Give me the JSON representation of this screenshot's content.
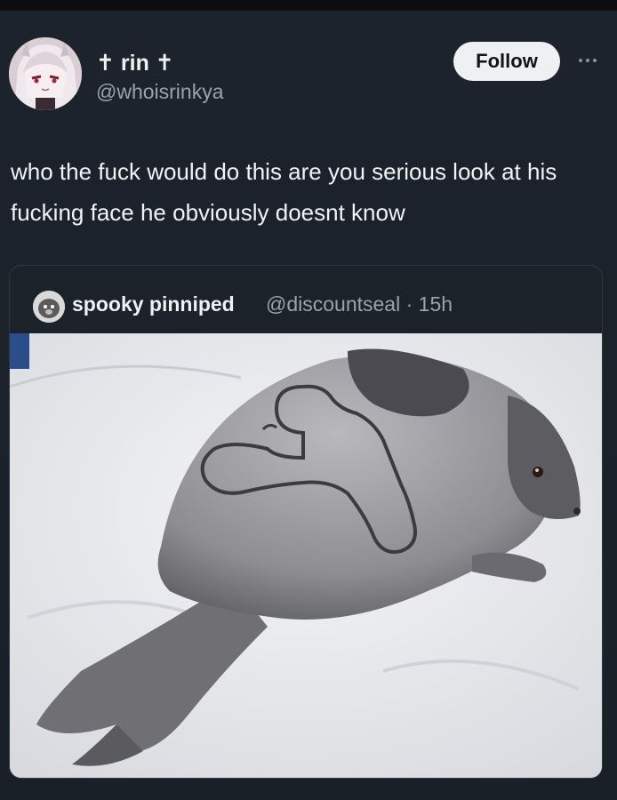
{
  "post": {
    "author": {
      "display_name": "✝ rin ✝",
      "handle": "@whoisrinkya"
    },
    "follow_label": "Follow",
    "more_icon": "more-dots-icon",
    "text": "who the fuck would do this are you serious look at his fucking face he obviously doesnt know"
  },
  "quoted_post": {
    "author": {
      "display_name": "spooky pinniped",
      "handle": "@discountseal",
      "time_ago": "15h"
    },
    "media_description": "seal-photo"
  },
  "colors": {
    "background": "#1d232c",
    "text_primary": "#eef0f2",
    "text_secondary": "#9aa3ad",
    "follow_button_bg": "#eef0f2"
  }
}
